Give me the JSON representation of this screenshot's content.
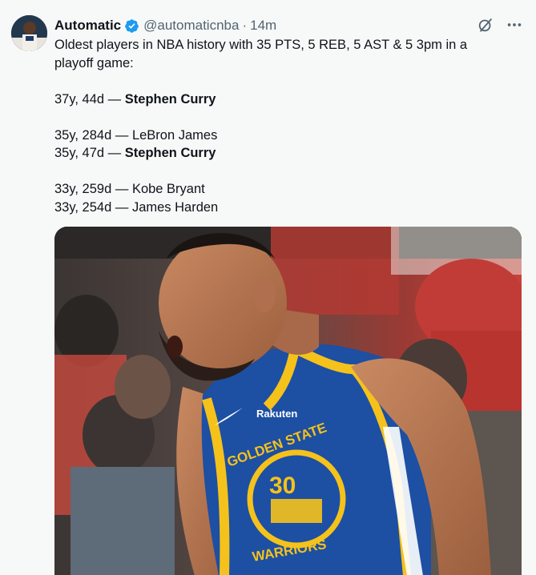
{
  "author": {
    "name": "Automatic",
    "handle": "@automaticnba",
    "separator": "·",
    "time": "14m"
  },
  "tweet": {
    "intro_line1": "Oldest players in NBA history with 35 PTS, 5 REB, 5 AST & 5 3pm in a",
    "intro_line2": "playoff game:",
    "entries": [
      {
        "age": "37y, 44d —",
        "player": "Stephen Curry",
        "bold": true
      },
      {
        "age": "35y, 284d —",
        "player": "LeBron James",
        "bold": false
      },
      {
        "age": "35y, 47d —",
        "player": "Stephen Curry",
        "bold": true
      },
      {
        "age": "33y, 259d —",
        "player": "Kobe Bryant",
        "bold": false
      },
      {
        "age": "33y, 254d —",
        "player": "James Harden",
        "bold": false
      }
    ]
  },
  "media": {
    "jersey_sponsor": "Rakuten",
    "jersey_team_top": "GOLDEN STATE",
    "jersey_team_bottom": "WARRIORS",
    "jersey_number": "30"
  },
  "icons": {
    "verified": "verified-badge-icon",
    "grok": "grok-icon",
    "more": "more-icon"
  },
  "colors": {
    "verified_blue": "#1d9bf0",
    "muted_text": "#536471",
    "jersey_blue": "#1d4fa3",
    "jersey_gold": "#f5c21b"
  }
}
